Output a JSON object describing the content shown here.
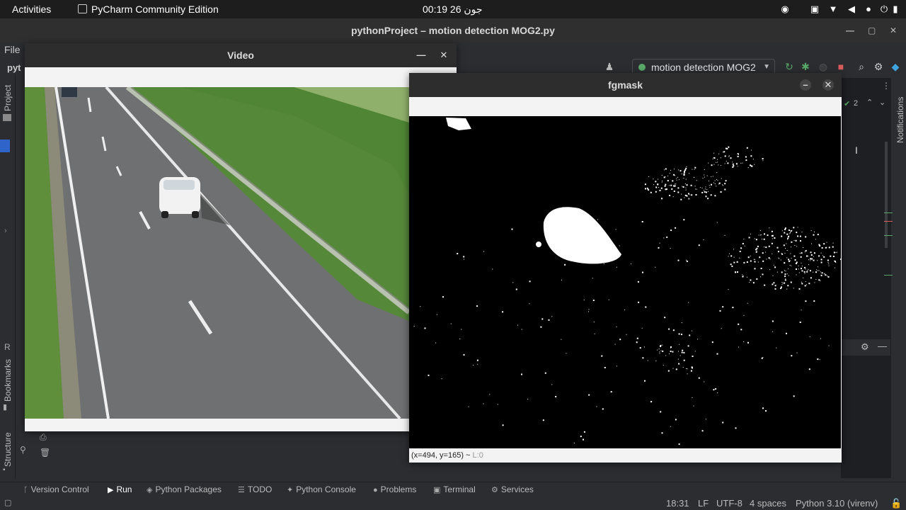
{
  "topbar": {
    "activities": "Activities",
    "app_name": "PyCharm Community Edition",
    "clock": "00:19 26 جون"
  },
  "ide": {
    "window_title": "pythonProject – motion detection MOG2.py",
    "menu_file": "File",
    "project_fragment": "pyt",
    "left_tabs": {
      "project": "Project",
      "bookmarks": "Bookmarks",
      "structure": "Structure"
    },
    "right_tabs": {
      "notifications": "Notifications"
    },
    "run_config": "motion detection MOG2",
    "inspection_count": "2",
    "run_panel_fragment": "R",
    "bottom_tools": [
      {
        "label": "Version Control",
        "icon": "branch-icon"
      },
      {
        "label": "Run",
        "icon": "play-icon"
      },
      {
        "label": "Python Packages",
        "icon": "layers-icon"
      },
      {
        "label": "TODO",
        "icon": "list-icon"
      },
      {
        "label": "Python Console",
        "icon": "python-icon"
      },
      {
        "label": "Problems",
        "icon": "info-icon"
      },
      {
        "label": "Terminal",
        "icon": "terminal-icon"
      },
      {
        "label": "Services",
        "icon": "services-icon"
      }
    ],
    "status": {
      "position": "18:31",
      "line_ending": "LF",
      "encoding": "UTF-8",
      "indent": "4 spaces",
      "interpreter": "Python 3.10 (virenv)"
    }
  },
  "video_window": {
    "title": "Video"
  },
  "mask_window": {
    "title": "fgmask",
    "status_text": "(x=494, y=165) ~ ",
    "status_suffix": "L:0"
  },
  "colors": {
    "ide_bg": "#2b2d30",
    "topbar_bg": "#1d1d1d",
    "cv_frame": "#f3f3f3",
    "grass": "#5f8f3a",
    "asphalt": "#6f7071",
    "run_accent": "#59a869",
    "stop_red": "#db5c5c"
  }
}
